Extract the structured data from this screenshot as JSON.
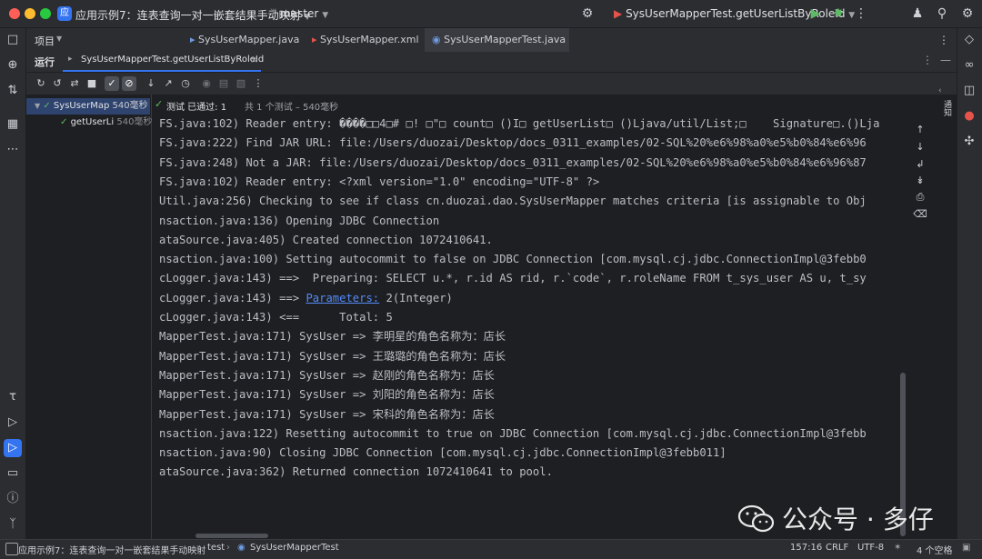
{
  "titlebar": {
    "project_badge": "应",
    "project_name": "应用示例7：连表查询一对一嵌套结果手动映射",
    "branch": "master",
    "run_config": "SysUserMapperTest.getUserListByRoleId"
  },
  "project_panel": {
    "label": "项目"
  },
  "editor_tabs": [
    {
      "label": "SysUserMapper.java",
      "active": false
    },
    {
      "label": "SysUserMapper.xml",
      "active": false
    },
    {
      "label": "SysUserMapperTest.java",
      "active": true
    }
  ],
  "run_panel": {
    "title": "运行",
    "tab_label": "SysUserMapperTest.getUserListByRoleId"
  },
  "test_status": {
    "prefix": "测试 已通过: 1",
    "detail": "共 1 个测试 – 540毫秒"
  },
  "test_tree": [
    {
      "label": "SysUserMap",
      "time": "540毫秒",
      "selected": true
    },
    {
      "label": "getUserLi",
      "time": "540毫秒",
      "selected": false
    }
  ],
  "console_lines": [
    {
      "text": "FS.java:102) Reader entry: ����□□4□# □! □\"□ count□ ()I□ getUserList□ ()Ljava/util/List;□    Signature□.()Lja"
    },
    {
      "text": "FS.java:222) Find JAR URL: file:/Users/duozai/Desktop/docs_0311_examples/02-SQL%20%e6%98%a0%e5%b0%84%e6%96"
    },
    {
      "text": "FS.java:248) Not a JAR: file:/Users/duozai/Desktop/docs_0311_examples/02-SQL%20%e6%98%a0%e5%b0%84%e6%96%87"
    },
    {
      "text": "FS.java:102) Reader entry: <?xml version=\"1.0\" encoding=\"UTF-8\" ?>"
    },
    {
      "text": "Util.java:256) Checking to see if class cn.duozai.dao.SysUserMapper matches criteria [is assignable to Obj"
    },
    {
      "text": "nsaction.java:136) Opening JDBC Connection"
    },
    {
      "text": "ataSource.java:405) Created connection 1072410641."
    },
    {
      "text": "nsaction.java:100) Setting autocommit to false on JDBC Connection [com.mysql.cj.jdbc.ConnectionImpl@3febb0"
    },
    {
      "text": "cLogger.java:143) ==>  Preparing: SELECT u.*, r.id AS rid, r.`code`, r.roleName FROM t_sys_user AS u, t_sy"
    },
    {
      "text": "cLogger.java:143) ==> ",
      "link": "Parameters:",
      "after": " 2(Integer)"
    },
    {
      "text": "cLogger.java:143) <==      Total: 5"
    },
    {
      "text": "MapperTest.java:171) SysUser => 李明星的角色名称为：店长"
    },
    {
      "text": "MapperTest.java:171) SysUser => 王璐璐的角色名称为：店长"
    },
    {
      "text": "MapperTest.java:171) SysUser => 赵刚的角色名称为：店长"
    },
    {
      "text": "MapperTest.java:171) SysUser => 刘阳的角色名称为：店长"
    },
    {
      "text": "MapperTest.java:171) SysUser => 宋科的角色名称为：店长"
    },
    {
      "text": "nsaction.java:122) Resetting autocommit to true on JDBC Connection [com.mysql.cj.jdbc.ConnectionImpl@3febb"
    },
    {
      "text": "nsaction.java:90) Closing JDBC Connection [com.mysql.cj.jdbc.ConnectionImpl@3febb011]"
    },
    {
      "text": "ataSource.java:362) Returned connection 1072410641 to pool."
    }
  ],
  "right_tool_label": "通知",
  "statusbar": {
    "breadcrumb_project": "应用示例7：连表查询一对一嵌套结果手动映射",
    "breadcrumb_folder": "test",
    "breadcrumb_file": "SysUserMapperTest",
    "cursor": "157:16",
    "line_sep": "CRLF",
    "encoding": "UTF-8",
    "indent": "4 个空格"
  },
  "watermark": "公众号 · 多仔",
  "colors": {
    "accent": "#3574f0",
    "pass": "#5fb865",
    "bg": "#1e1f22",
    "panel": "#2b2d30"
  }
}
